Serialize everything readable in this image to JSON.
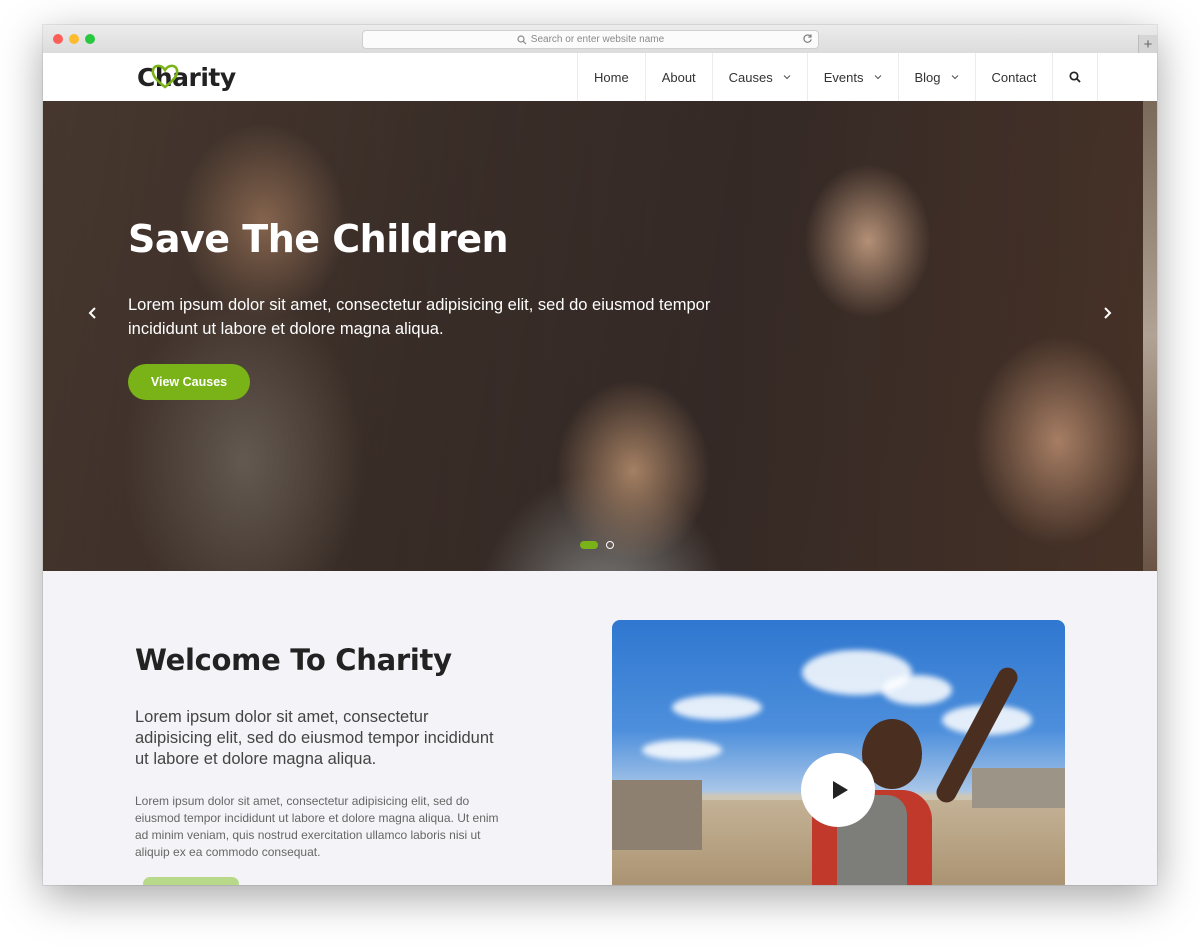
{
  "browser": {
    "address_placeholder": "Search or enter website name",
    "new_tab": "+"
  },
  "site": {
    "logo": "Charity",
    "brand_color": "#7ab317"
  },
  "nav": {
    "items": [
      {
        "label": "Home",
        "dropdown": false
      },
      {
        "label": "About",
        "dropdown": false
      },
      {
        "label": "Causes",
        "dropdown": true
      },
      {
        "label": "Events",
        "dropdown": true
      },
      {
        "label": "Blog",
        "dropdown": true
      },
      {
        "label": "Contact",
        "dropdown": false
      }
    ],
    "search_icon": "search-icon"
  },
  "hero": {
    "title": "Save The Children",
    "text": "Lorem ipsum dolor sit amet, consectetur adipisicing elit, sed do eiusmod tempor incididunt ut labore et dolore magna aliqua.",
    "button": "View Causes",
    "slide_count": 2,
    "active_slide": 1
  },
  "welcome": {
    "title": "Welcome To Charity",
    "lead": "Lorem ipsum dolor sit amet, consectetur adipisicing elit, sed do eiusmod tempor incididunt ut labore et dolore magna aliqua.",
    "body": "Lorem ipsum dolor sit amet, consectetur adipisicing elit, sed do eiusmod tempor incididunt ut labore et dolore magna aliqua. Ut enim ad minim veniam, quis nostrud exercitation ullamco laboris nisi ut aliquip ex ea commodo consequat.",
    "video_icon": "play-icon"
  }
}
